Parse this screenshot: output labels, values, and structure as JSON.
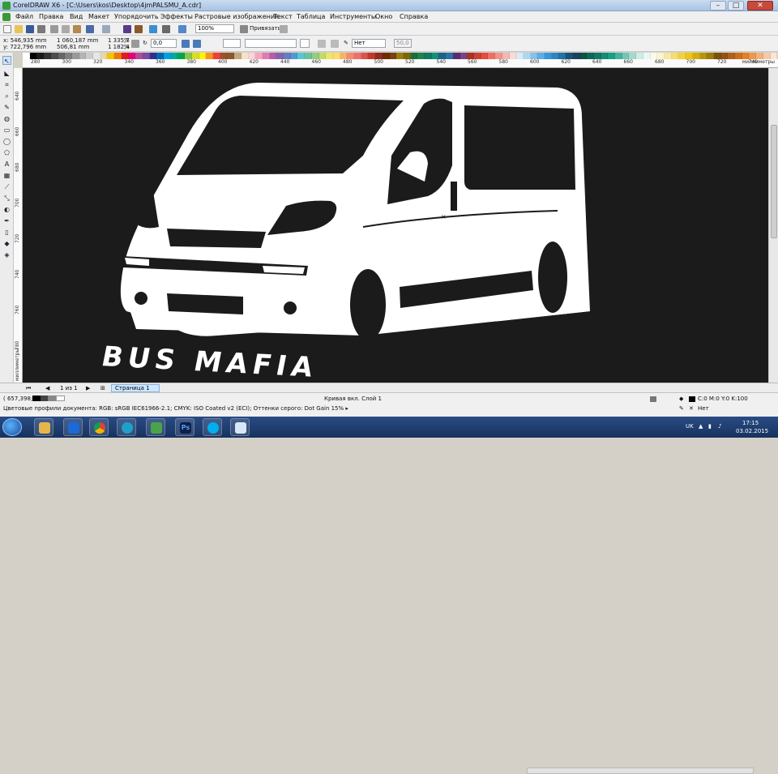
{
  "window": {
    "title": "CorelDRAW X6 - [C:\\Users\\kos\\Desktop\\4jmPALSMU_A.cdr]",
    "minimize": "–",
    "maximize": "□",
    "close": "✕"
  },
  "menu": [
    "Файл",
    "Правка",
    "Вид",
    "Макет",
    "Упорядочить",
    "Эффекты",
    "Растровые изображения",
    "Текст",
    "Таблица",
    "Инструменты",
    "Окно",
    "Справка"
  ],
  "toolbar": {
    "zoom": "100%",
    "snap_label": "Привязать к"
  },
  "property_bar": {
    "x": "x: 546,935 mm",
    "y": "y: 722,796 mm",
    "width": "1 060,187 mm",
    "height": "506,81 mm",
    "scale_x": "1 335,7",
    "scale_y": "1 182,4",
    "pct": "%",
    "angle": "0,0",
    "outline": "Нет",
    "value": "50,0"
  },
  "ruler": {
    "h_ticks": [
      "280",
      "300",
      "320",
      "340",
      "360",
      "380",
      "400",
      "420",
      "440",
      "460",
      "480",
      "500",
      "520",
      "540",
      "560",
      "580",
      "600",
      "620",
      "640",
      "660",
      "680",
      "700",
      "720",
      "740"
    ],
    "unit": "миллиметры",
    "v_ticks": [
      "640",
      "660",
      "680",
      "700",
      "720",
      "740",
      "760",
      "780"
    ],
    "v_unit": "миллиметры"
  },
  "canvas": {
    "text": "BUS MAFIA",
    "bg_color": "#1b1b1b",
    "fg_color": "#ffffff"
  },
  "pagebar": {
    "page_count": "1 из 1",
    "page_tab": "Страница 1"
  },
  "status": {
    "coords": "( 657,398; 737,1... ▸",
    "object_info": "Кривая вкл. Слой 1",
    "color_profile": "Цветовые профили документа: RGB: sRGB IEC61966-2.1; CMYK: ISO Coated v2 (ECI); Оттенки серого: Dot Gain 15% ▸",
    "fill": "C:0 M:0 Y:0 K:100",
    "outline": "Нет"
  },
  "taskbar": {
    "lang": "UK",
    "time": "17:15",
    "date": "03.02.2015",
    "ps_label": "Ps"
  },
  "colors": {
    "palette": [
      "#ffffff",
      "#000000",
      "#1a1a1a",
      "#333333",
      "#4d4d4d",
      "#666666",
      "#808080",
      "#999999",
      "#b3b3b3",
      "#cccccc",
      "#e6e6e6",
      "#e8d6b0",
      "#f5c400",
      "#f07800",
      "#e11b22",
      "#e6007e",
      "#b24b9b",
      "#7b4ba0",
      "#2e3192",
      "#0067b1",
      "#00a0e3",
      "#00a99d",
      "#00a651",
      "#8dc63f",
      "#d7df23",
      "#fff200",
      "#f7941d",
      "#ee4036",
      "#a0522d",
      "#8b5a2b",
      "#c8a97e",
      "#f2e3c6",
      "#ffd1dc",
      "#f4a6c0",
      "#e07bb0",
      "#b05fa8",
      "#8464ab",
      "#6a7bbf",
      "#4e9ad3",
      "#5cc6d0",
      "#6bc29c",
      "#93cf7a",
      "#c2dc6a",
      "#eae76c",
      "#fbdc6c",
      "#f9b16c",
      "#f48c6c",
      "#ef6f6c",
      "#d9534f",
      "#c0392b",
      "#922b21",
      "#6e2c00",
      "#784212",
      "#9a7d0a",
      "#7d6608",
      "#196f3d",
      "#1e8449",
      "#117a65",
      "#148f77",
      "#1f618d",
      "#2874a6",
      "#5b2c6f",
      "#76448a",
      "#a93226",
      "#cb4335",
      "#e74c3c",
      "#ec7063",
      "#f1948a",
      "#f5b7b1",
      "#fadbd8",
      "#d6eaf8",
      "#aed6f1",
      "#85c1e9",
      "#5dade2",
      "#3498db",
      "#2e86c1",
      "#2471a3",
      "#1a5276",
      "#154360",
      "#0b5345",
      "#0e6655",
      "#117864",
      "#138d75",
      "#16a085",
      "#45b39d",
      "#73c6b6",
      "#a2d9ce",
      "#d0ece7",
      "#e8f8f5",
      "#fef9e7",
      "#fcf3cf",
      "#f9e79f",
      "#f7dc6f",
      "#f4d03f",
      "#f1c40f",
      "#d4ac0d",
      "#b7950b",
      "#9a7d0a",
      "#7e5109",
      "#935116",
      "#af601a",
      "#ca6f1e",
      "#e67e22",
      "#eb984e",
      "#f0b27a",
      "#f5cba7",
      "#fae5d3"
    ]
  }
}
